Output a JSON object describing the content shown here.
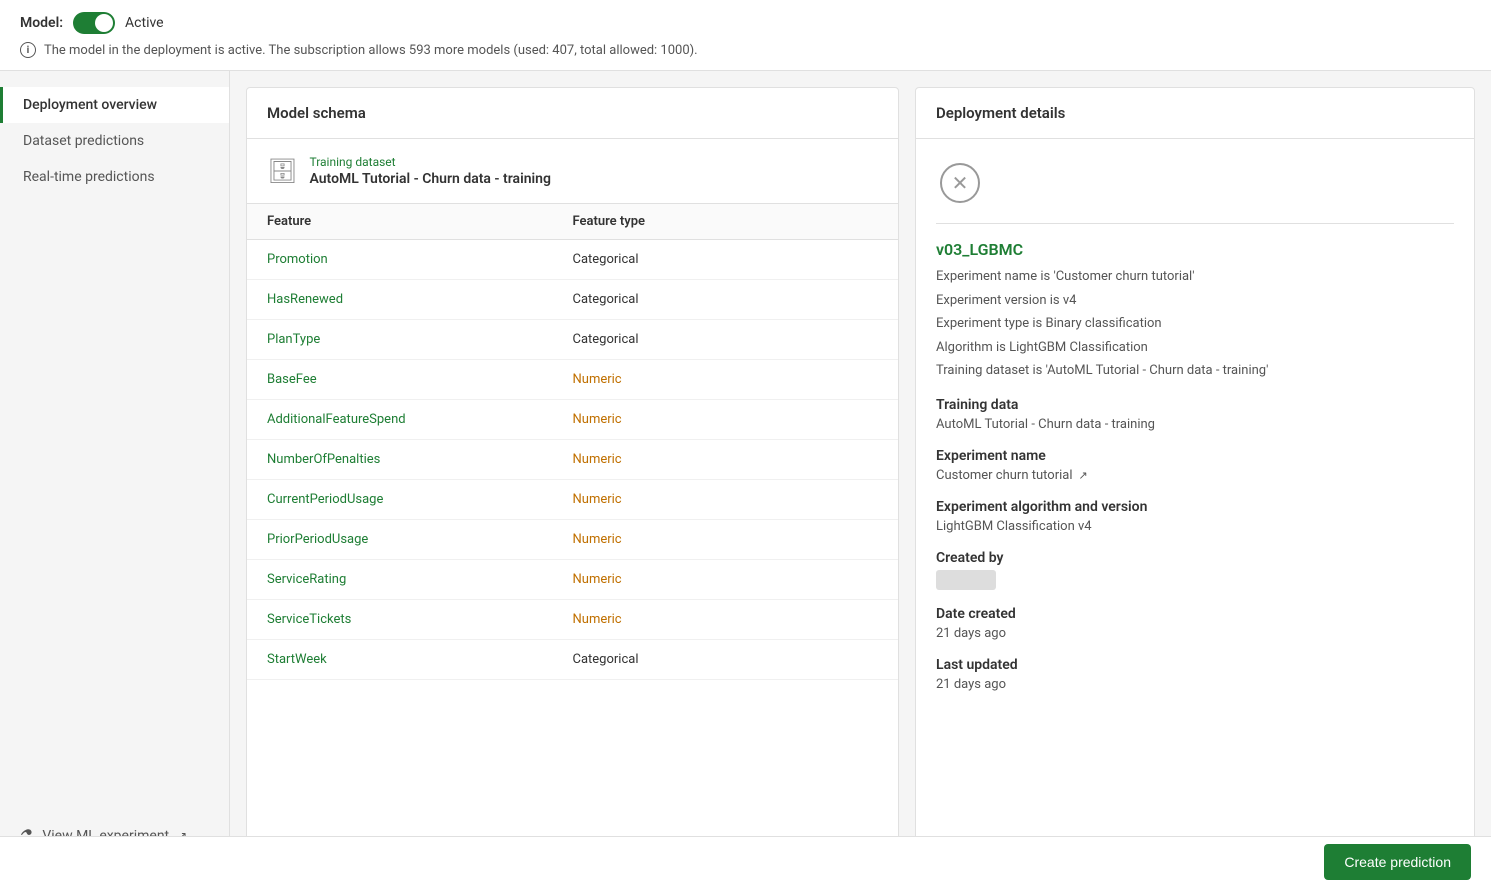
{
  "header": {
    "model_label": "Model:",
    "model_status": "Active",
    "info_text": "The model in the deployment is active. The subscription allows 593 more models (used: 407, total allowed: 1000)."
  },
  "sidebar": {
    "items": [
      {
        "id": "deployment-overview",
        "label": "Deployment overview",
        "active": true
      },
      {
        "id": "dataset-predictions",
        "label": "Dataset predictions",
        "active": false
      },
      {
        "id": "real-time-predictions",
        "label": "Real-time predictions",
        "active": false
      }
    ],
    "footer_link": "View ML experiment",
    "footer_icon": "experiment"
  },
  "model_schema": {
    "title": "Model schema",
    "training_dataset_label": "Training dataset",
    "training_dataset_name": "AutoML Tutorial - Churn data - training",
    "table_headers": {
      "feature": "Feature",
      "feature_type": "Feature type"
    },
    "rows": [
      {
        "feature": "Promotion",
        "type": "Categorical",
        "numeric": false
      },
      {
        "feature": "HasRenewed",
        "type": "Categorical",
        "numeric": false
      },
      {
        "feature": "PlanType",
        "type": "Categorical",
        "numeric": false
      },
      {
        "feature": "BaseFee",
        "type": "Numeric",
        "numeric": true
      },
      {
        "feature": "AdditionalFeatureSpend",
        "type": "Numeric",
        "numeric": true
      },
      {
        "feature": "NumberOfPenalties",
        "type": "Numeric",
        "numeric": true
      },
      {
        "feature": "CurrentPeriodUsage",
        "type": "Numeric",
        "numeric": true
      },
      {
        "feature": "PriorPeriodUsage",
        "type": "Numeric",
        "numeric": true
      },
      {
        "feature": "ServiceRating",
        "type": "Numeric",
        "numeric": true
      },
      {
        "feature": "ServiceTickets",
        "type": "Numeric",
        "numeric": true
      },
      {
        "feature": "StartWeek",
        "type": "Categorical",
        "numeric": false
      }
    ]
  },
  "deployment_details": {
    "title": "Deployment details",
    "model_version": "v03_LGBMC",
    "experiment_name_label": "Experiment name is",
    "experiment_name_value": "'Customer churn tutorial'",
    "experiment_version_label": "Experiment version is",
    "experiment_version_value": "v4",
    "experiment_type_label": "Experiment type is",
    "experiment_type_value": "Binary classification",
    "algorithm_label": "Algorithm is",
    "algorithm_value": "LightGBM Classification",
    "training_dataset_label_detail": "Training dataset is",
    "training_dataset_value": "'AutoML Tutorial - Churn data - training'",
    "sections": [
      {
        "id": "training-data",
        "label": "Training data",
        "value": "AutoML Tutorial - Churn data - training"
      },
      {
        "id": "experiment-name",
        "label": "Experiment name",
        "value": "Customer churn tutorial",
        "has_link": true
      },
      {
        "id": "experiment-algorithm",
        "label": "Experiment algorithm and version",
        "value": "LightGBM Classification v4"
      },
      {
        "id": "created-by",
        "label": "Created by",
        "value": "",
        "has_avatar": true
      },
      {
        "id": "date-created",
        "label": "Date created",
        "value": "21 days ago"
      },
      {
        "id": "last-updated",
        "label": "Last updated",
        "value": "21 days ago"
      }
    ]
  },
  "footer": {
    "create_prediction_label": "Create prediction"
  }
}
